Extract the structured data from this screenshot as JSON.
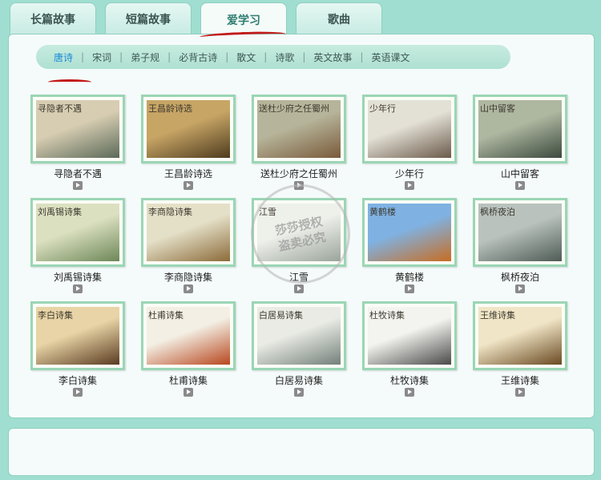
{
  "tabs": [
    {
      "label": "长篇故事",
      "active": false
    },
    {
      "label": "短篇故事",
      "active": false
    },
    {
      "label": "爱学习",
      "active": true
    },
    {
      "label": "歌曲",
      "active": false
    }
  ],
  "subnav": [
    {
      "label": "唐诗",
      "active": true
    },
    {
      "label": "宋词"
    },
    {
      "label": "弟子规"
    },
    {
      "label": "必背古诗"
    },
    {
      "label": "散文"
    },
    {
      "label": "诗歌"
    },
    {
      "label": "英文故事"
    },
    {
      "label": "英语课文"
    }
  ],
  "cards": [
    {
      "title": "寻隐者不遇",
      "art_text": "寻隐者不遇",
      "colors": [
        "#d7cdb2",
        "#5b6a58"
      ]
    },
    {
      "title": "王昌龄诗选",
      "art_text": "王昌龄诗选",
      "colors": [
        "#c7a565",
        "#4e3b1e"
      ]
    },
    {
      "title": "送杜少府之任蜀州",
      "art_text": "送杜少府之任蜀州",
      "colors": [
        "#b6b49a",
        "#7a5a3a"
      ]
    },
    {
      "title": "少年行",
      "art_text": "少年行",
      "colors": [
        "#e3e0d6",
        "#6b5a4a"
      ]
    },
    {
      "title": "山中留客",
      "art_text": "山中留客",
      "colors": [
        "#aeb7a0",
        "#3c4a3e"
      ]
    },
    {
      "title": "刘禹锡诗集",
      "art_text": "刘禹锡诗集",
      "colors": [
        "#dbe0c0",
        "#6d8758"
      ]
    },
    {
      "title": "李商隐诗集",
      "art_text": "李商隐诗集",
      "colors": [
        "#e4e0c8",
        "#8c6b3a"
      ]
    },
    {
      "title": "江雪",
      "art_text": "江雪",
      "colors": [
        "#eef0ea",
        "#9aa49a"
      ]
    },
    {
      "title": "黄鹤楼",
      "art_text": "黄鹤楼",
      "colors": [
        "#7fb2e3",
        "#c86d22"
      ]
    },
    {
      "title": "枫桥夜泊",
      "art_text": "枫桥夜泊",
      "colors": [
        "#b9c2bd",
        "#4f5b55"
      ]
    },
    {
      "title": "李白诗集",
      "art_text": "李白诗集",
      "colors": [
        "#e8d4a6",
        "#5a3b20"
      ]
    },
    {
      "title": "杜甫诗集",
      "art_text": "杜甫诗集",
      "colors": [
        "#f3efe4",
        "#b8471f"
      ]
    },
    {
      "title": "白居易诗集",
      "art_text": "白居易诗集",
      "colors": [
        "#e9ebe4",
        "#74807a"
      ]
    },
    {
      "title": "杜牧诗集",
      "art_text": "杜牧诗集",
      "colors": [
        "#f3f3ef",
        "#4a4a4a"
      ]
    },
    {
      "title": "王维诗集",
      "art_text": "王维诗集",
      "colors": [
        "#f0e5c6",
        "#6a4a22"
      ]
    }
  ],
  "watermark": {
    "line1": "莎莎授权",
    "line2": "盗卖必究"
  }
}
